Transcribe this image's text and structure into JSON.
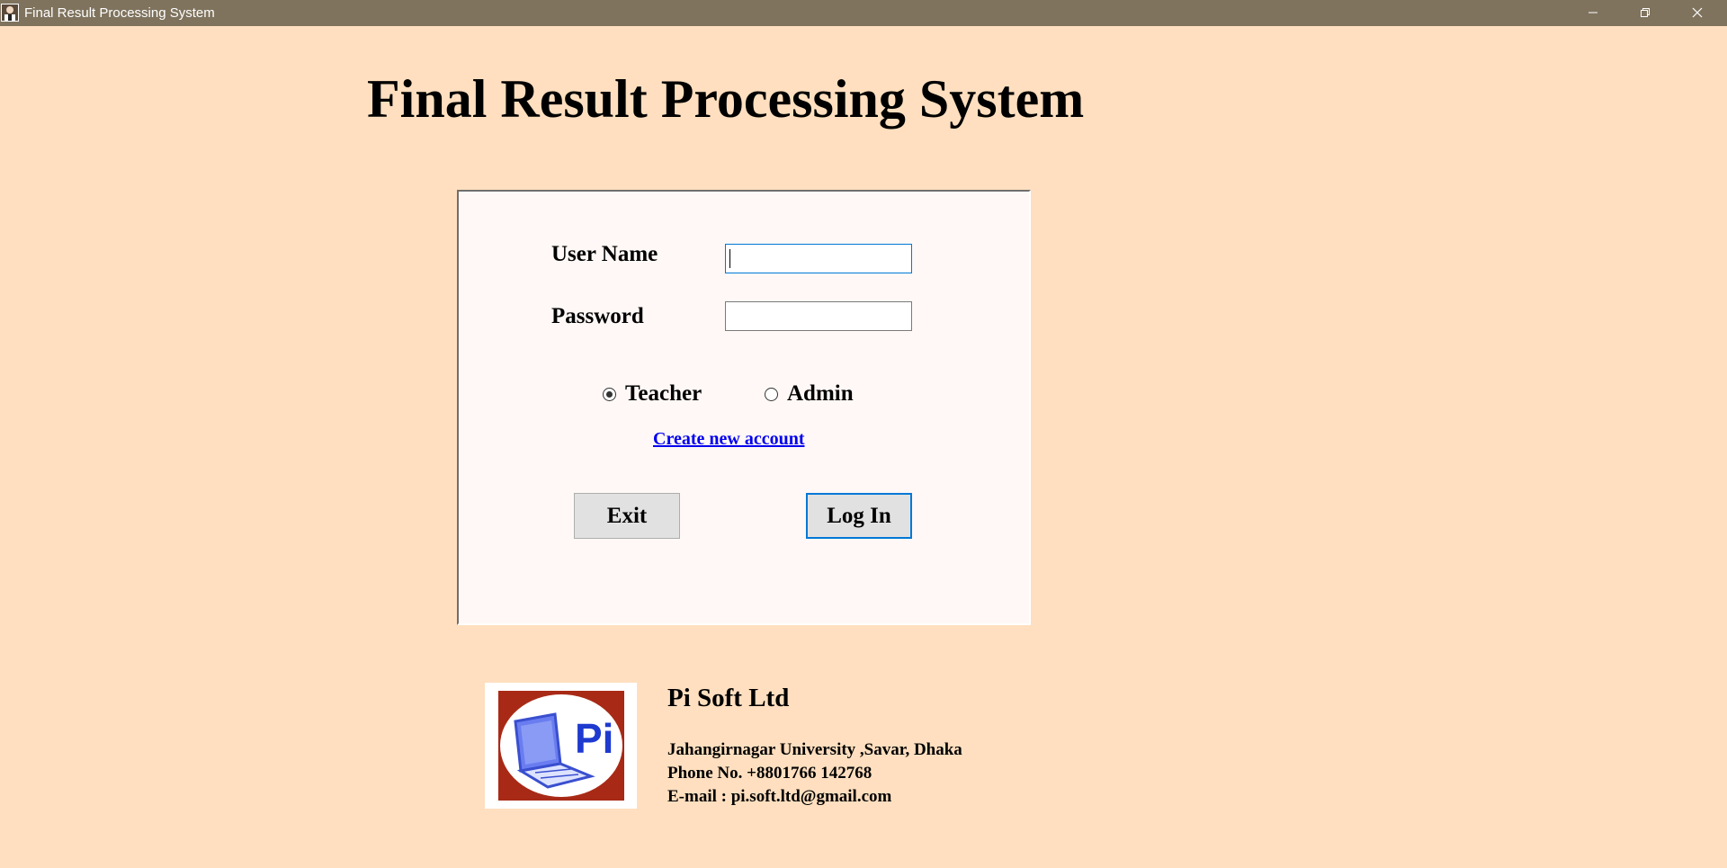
{
  "window": {
    "title": "Final Result Processing System",
    "icon": "app-icon",
    "controls": [
      "minimize-icon",
      "restore-icon",
      "close-icon"
    ]
  },
  "page": {
    "heading": "Final Result Processing System"
  },
  "login": {
    "username_label": "User Name",
    "username_value": "",
    "password_label": "Password",
    "password_value": "",
    "role_options": [
      {
        "label": "Teacher",
        "selected": true
      },
      {
        "label": "Admin",
        "selected": false
      }
    ],
    "create_account_link": "Create new account",
    "exit_button": "Exit",
    "login_button": "Log In"
  },
  "footer": {
    "logo_text": "Pi",
    "company_name": "Pi Soft Ltd",
    "address": "Jahangirnagar University ,Savar, Dhaka",
    "phone": "Phone No. +8801766 142768",
    "email": "E-mail : pi.soft.ltd@gmail.com"
  },
  "colors": {
    "background": "#FFDFBF",
    "titlebar": "#7F735E",
    "panel": "#FFF8F6",
    "focus_border": "#0078D7",
    "link": "#0000EE",
    "logo_red": "#A82A16",
    "logo_blue": "#1E3ACF"
  }
}
